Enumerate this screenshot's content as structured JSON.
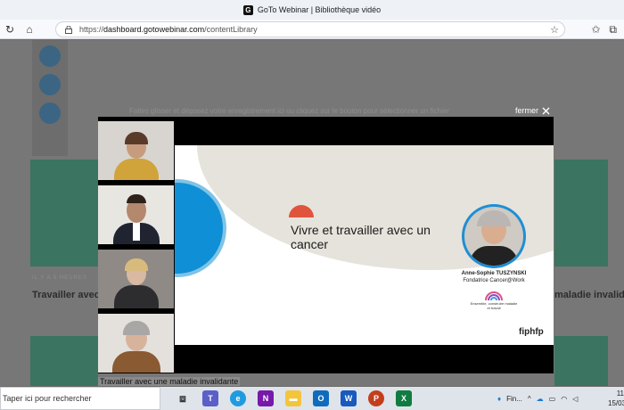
{
  "window": {
    "title": "GoTo Webinar | Bibliothèque vidéo"
  },
  "browser": {
    "url_prefix": "https://",
    "url_host": "dashboard.gotowebinar.com",
    "url_path": "/contentLibrary"
  },
  "background_page": {
    "hint_text": "Faites glisser et déposez votre enregistrement ici ou cliquez sur le bouton pour sélectionner un fichier",
    "card_meta": "IL Y A 5 HEURES",
    "card_title_left": "Travailler avec",
    "card_title_right": "maladie invalidante"
  },
  "modal": {
    "close_label": "fermer",
    "caption": "Travailler avec une maladie invalidante",
    "slide": {
      "title": "Vivre et travailler avec un cancer",
      "speaker_name": "Anne-Sophie TUSZYNSKI",
      "speaker_role": "Fondatrice Cancer@Work",
      "logo_text": "Ensemble, construire maladie et travail",
      "fiphfp_logo": "fiphfp"
    }
  },
  "taskbar": {
    "search_text": "Taper ici pour rechercher",
    "tray_label": "Fin...",
    "clock_time": "11",
    "clock_date": "15/03"
  },
  "colors": {
    "accent_blue": "#0f8fd6",
    "accent_red": "#e0543d",
    "green_tiles": "#3b7461"
  }
}
